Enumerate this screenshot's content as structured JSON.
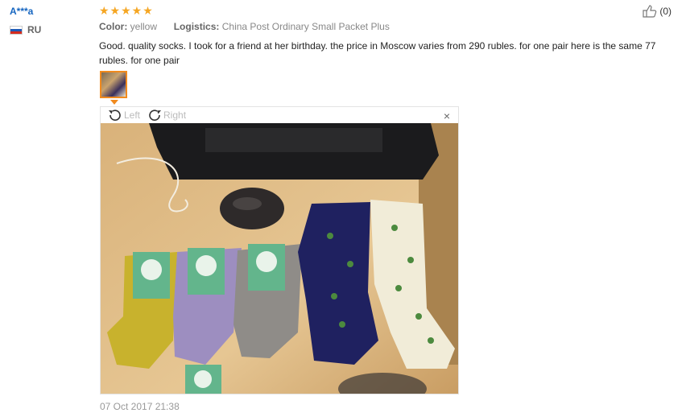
{
  "user": {
    "name": "A***a",
    "country": "RU"
  },
  "review": {
    "stars": "★★★★★",
    "color_label": "Color:",
    "color_value": "yellow",
    "logistics_label": "Logistics:",
    "logistics_value": "China Post Ordinary Small Packet Plus",
    "text": "Good. quality socks. I took for a friend at her birthday. the price in Moscow varies from 290 rubles. for one pair here is the same 77 rubles. for one pair",
    "date": "07 Oct 2017 21:38"
  },
  "helpful": {
    "count": "(0)"
  },
  "viewer": {
    "left_label": "Left",
    "right_label": "Right",
    "close_label": "×"
  },
  "colors": {
    "link_blue": "#1565c0",
    "star_orange": "#f5a623",
    "accent_orange": "#f08a1e"
  }
}
